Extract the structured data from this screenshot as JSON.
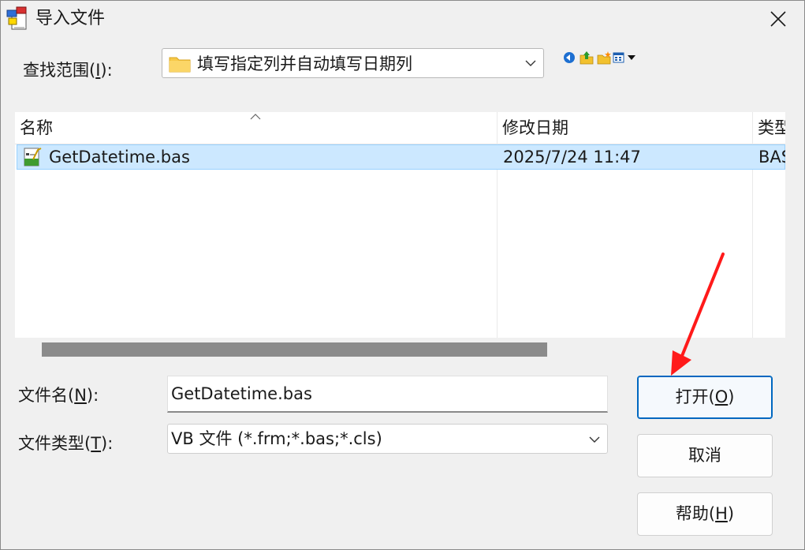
{
  "window": {
    "title": "导入文件",
    "close_label": "×"
  },
  "lookin": {
    "label_prefix": "查找范围(",
    "label_mnemonic": "I",
    "label_suffix": "):",
    "value": "填写指定列并自动填写日期列"
  },
  "toolbar": {
    "icons": [
      "back-icon",
      "up-folder-icon",
      "new-folder-icon",
      "view-menu-icon"
    ]
  },
  "list": {
    "columns": [
      {
        "label": "名称"
      },
      {
        "label": "修改日期"
      },
      {
        "label": "类型"
      }
    ],
    "rows": [
      {
        "name": "GetDatetime.bas",
        "modified": "2025/7/24 11:47",
        "type": "BAS"
      }
    ],
    "selected_row": 0
  },
  "filename": {
    "label_prefix": "文件名(",
    "label_mnemonic": "N",
    "label_suffix": "):",
    "value": "GetDatetime.bas"
  },
  "filetype": {
    "label_prefix": "文件类型(",
    "label_mnemonic": "T",
    "label_suffix": "):",
    "value": "VB 文件 (*.frm;*.bas;*.cls)"
  },
  "buttons": {
    "open": {
      "prefix": "打开(",
      "mnemonic": "O",
      "suffix": ")"
    },
    "cancel": {
      "label": "取消"
    },
    "help": {
      "prefix": "帮助(",
      "mnemonic": "H",
      "suffix": ")"
    }
  },
  "colors": {
    "selection": "#cce8ff",
    "selection_border": "#99d1ff",
    "accent": "#0067c0",
    "annotation_arrow": "#ff1a1a",
    "folder": "#f7c948"
  }
}
